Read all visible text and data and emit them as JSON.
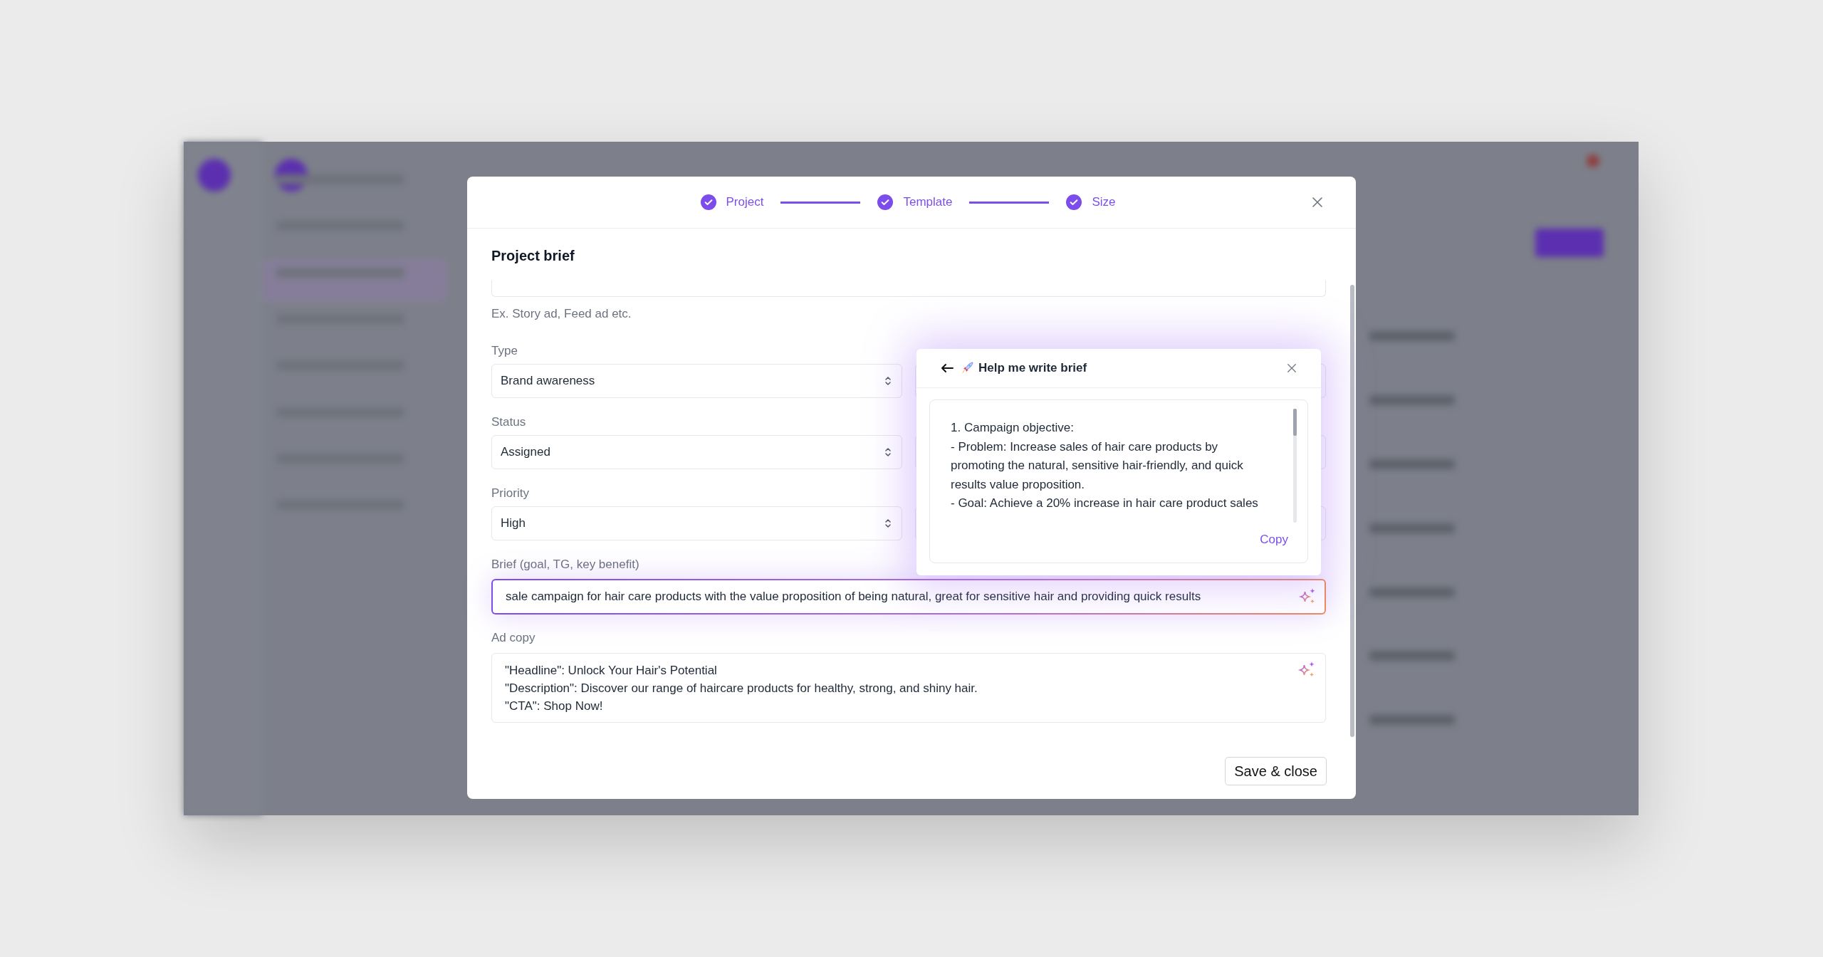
{
  "stepper": [
    {
      "label": "Project",
      "done": true
    },
    {
      "label": "Template",
      "done": true
    },
    {
      "label": "Size",
      "done": true
    }
  ],
  "title": "Project brief",
  "hint": "Ex. Story ad, Feed ad etc.",
  "selects": [
    {
      "label": "Type",
      "value": "Brand awareness"
    },
    {
      "label": "Status",
      "value": "Assigned"
    },
    {
      "label": "Priority",
      "value": "High"
    }
  ],
  "brief": {
    "label": "Brief (goal, TG, key benefit)",
    "value": "sale campaign for hair care products with the value proposition of being natural, great for sensitive hair and providing quick results",
    "focused": true
  },
  "ad_copy": {
    "label": "Ad copy",
    "lines": [
      "\"Headline\": Unlock Your Hair's Potential",
      "\"Description\": Discover our range of haircare products for healthy, strong, and shiny hair.",
      "\"CTA\": Shop Now!"
    ]
  },
  "save_button": "Save & close",
  "assistant": {
    "title": "Help me write brief",
    "lines": [
      "1. Campaign objective:",
      "- Problem: Increase sales of hair care products by promoting the natural, sensitive hair-friendly, and quick results value proposition.",
      "- Goal: Achieve a 20% increase in hair care product sales"
    ],
    "copy": "Copy"
  }
}
